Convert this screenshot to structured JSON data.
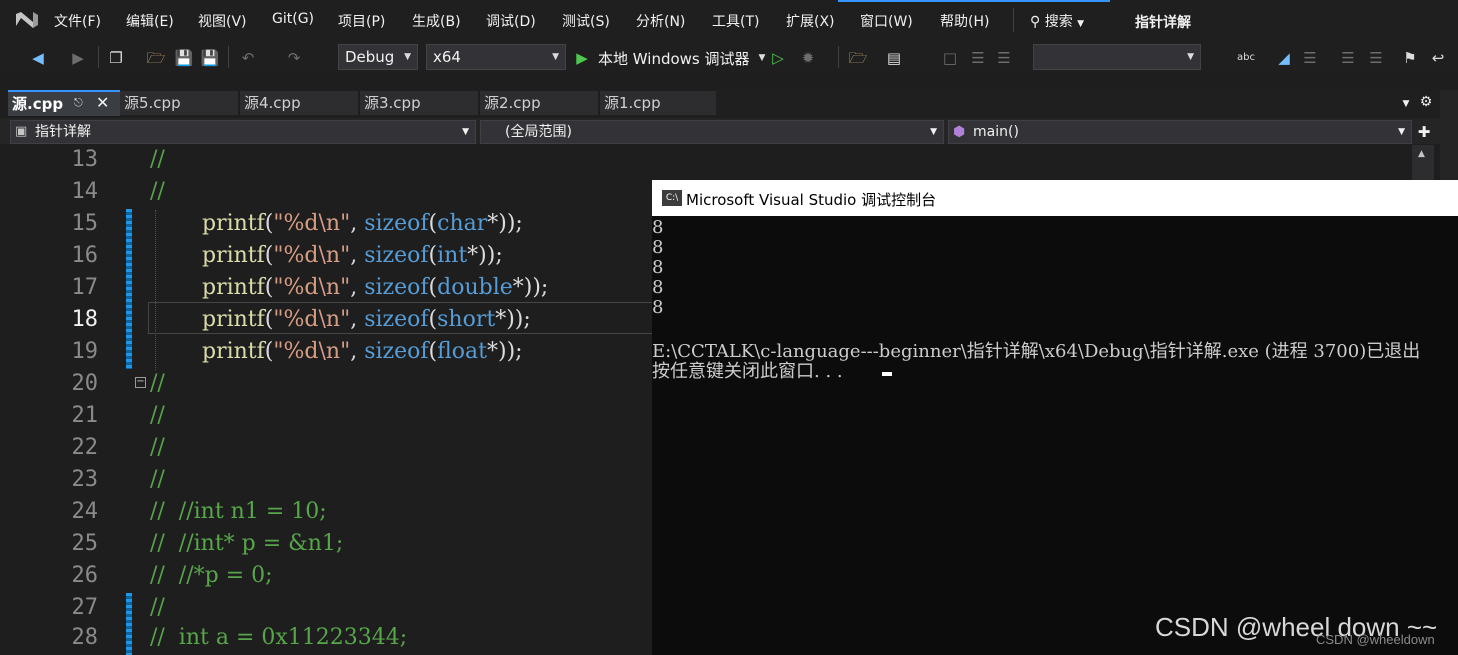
{
  "menubar": {
    "items": [
      "文件(F)",
      "编辑(E)",
      "视图(V)",
      "Git(G)",
      "项目(P)",
      "生成(B)",
      "调试(D)",
      "测试(S)",
      "分析(N)",
      "工具(T)",
      "扩展(X)",
      "窗口(W)",
      "帮助(H)"
    ],
    "search_label": "搜索",
    "solution_title": "指针详解"
  },
  "toolbar": {
    "config": "Debug",
    "platform": "x64",
    "run_label": "本地 Windows 调试器"
  },
  "tabs": [
    {
      "label": "源.cpp"
    },
    {
      "label": "源5.cpp"
    },
    {
      "label": "源4.cpp"
    },
    {
      "label": "源3.cpp"
    },
    {
      "label": "源2.cpp"
    },
    {
      "label": "源1.cpp"
    }
  ],
  "navbar": {
    "project": "指针详解",
    "scope": "(全局范围)",
    "member": "main()"
  },
  "editor": {
    "current_line": "18",
    "lines": [
      {
        "num": "13",
        "comment": "//"
      },
      {
        "num": "14",
        "comment": "//"
      },
      {
        "num": "15",
        "func": "printf",
        "p1": "(",
        "str": "\"%d\\n\"",
        "p2": ", ",
        "kw1": "sizeof",
        "p3": "(",
        "kw2": "char",
        "p4": "*));"
      },
      {
        "num": "16",
        "func": "printf",
        "p1": "(",
        "str": "\"%d\\n\"",
        "p2": ", ",
        "kw1": "sizeof",
        "p3": "(",
        "kw2": "int",
        "p4": "*));"
      },
      {
        "num": "17",
        "func": "printf",
        "p1": "(",
        "str": "\"%d\\n\"",
        "p2": ", ",
        "kw1": "sizeof",
        "p3": "(",
        "kw2": "double",
        "p4": "*));"
      },
      {
        "num": "18",
        "func": "printf",
        "p1": "(",
        "str": "\"%d\\n\"",
        "p2": ", ",
        "kw1": "sizeof",
        "p3": "(",
        "kw2": "short",
        "p4": "*));"
      },
      {
        "num": "19",
        "func": "printf",
        "p1": "(",
        "str": "\"%d\\n\"",
        "p2": ", ",
        "kw1": "sizeof",
        "p3": "(",
        "kw2": "float",
        "p4": "*));"
      },
      {
        "num": "20",
        "comment": "//"
      },
      {
        "num": "21",
        "comment": "//"
      },
      {
        "num": "22",
        "comment": "//"
      },
      {
        "num": "23",
        "comment": "//"
      },
      {
        "num": "24",
        "comment": "//  //int n1 = 10;"
      },
      {
        "num": "25",
        "comment": "//  //int* p = &n1;"
      },
      {
        "num": "26",
        "comment": "//  //*p = 0;"
      },
      {
        "num": "27",
        "comment": "//"
      },
      {
        "num": "28",
        "comment": "//  int a = 0x11223344;"
      }
    ]
  },
  "console": {
    "title": "Microsoft Visual Studio 调试控制台",
    "icon_label": "C:\\",
    "output": [
      "8",
      "8",
      "8",
      "8",
      "8",
      "",
      "E:\\CCTALK\\c-language---beginner\\指针详解\\x64\\Debug\\指针详解.exe (进程 3700)已退出",
      "按任意键关闭此窗口. . ."
    ]
  },
  "watermark": {
    "main": "CSDN @wheel down ~~",
    "small": "CSDN @wheeldown"
  },
  "colors": {
    "comment": "#57a64a",
    "keyword": "#569cd6",
    "string": "#d69d85",
    "function": "#dcdcaa",
    "accent": "#3794ff"
  }
}
